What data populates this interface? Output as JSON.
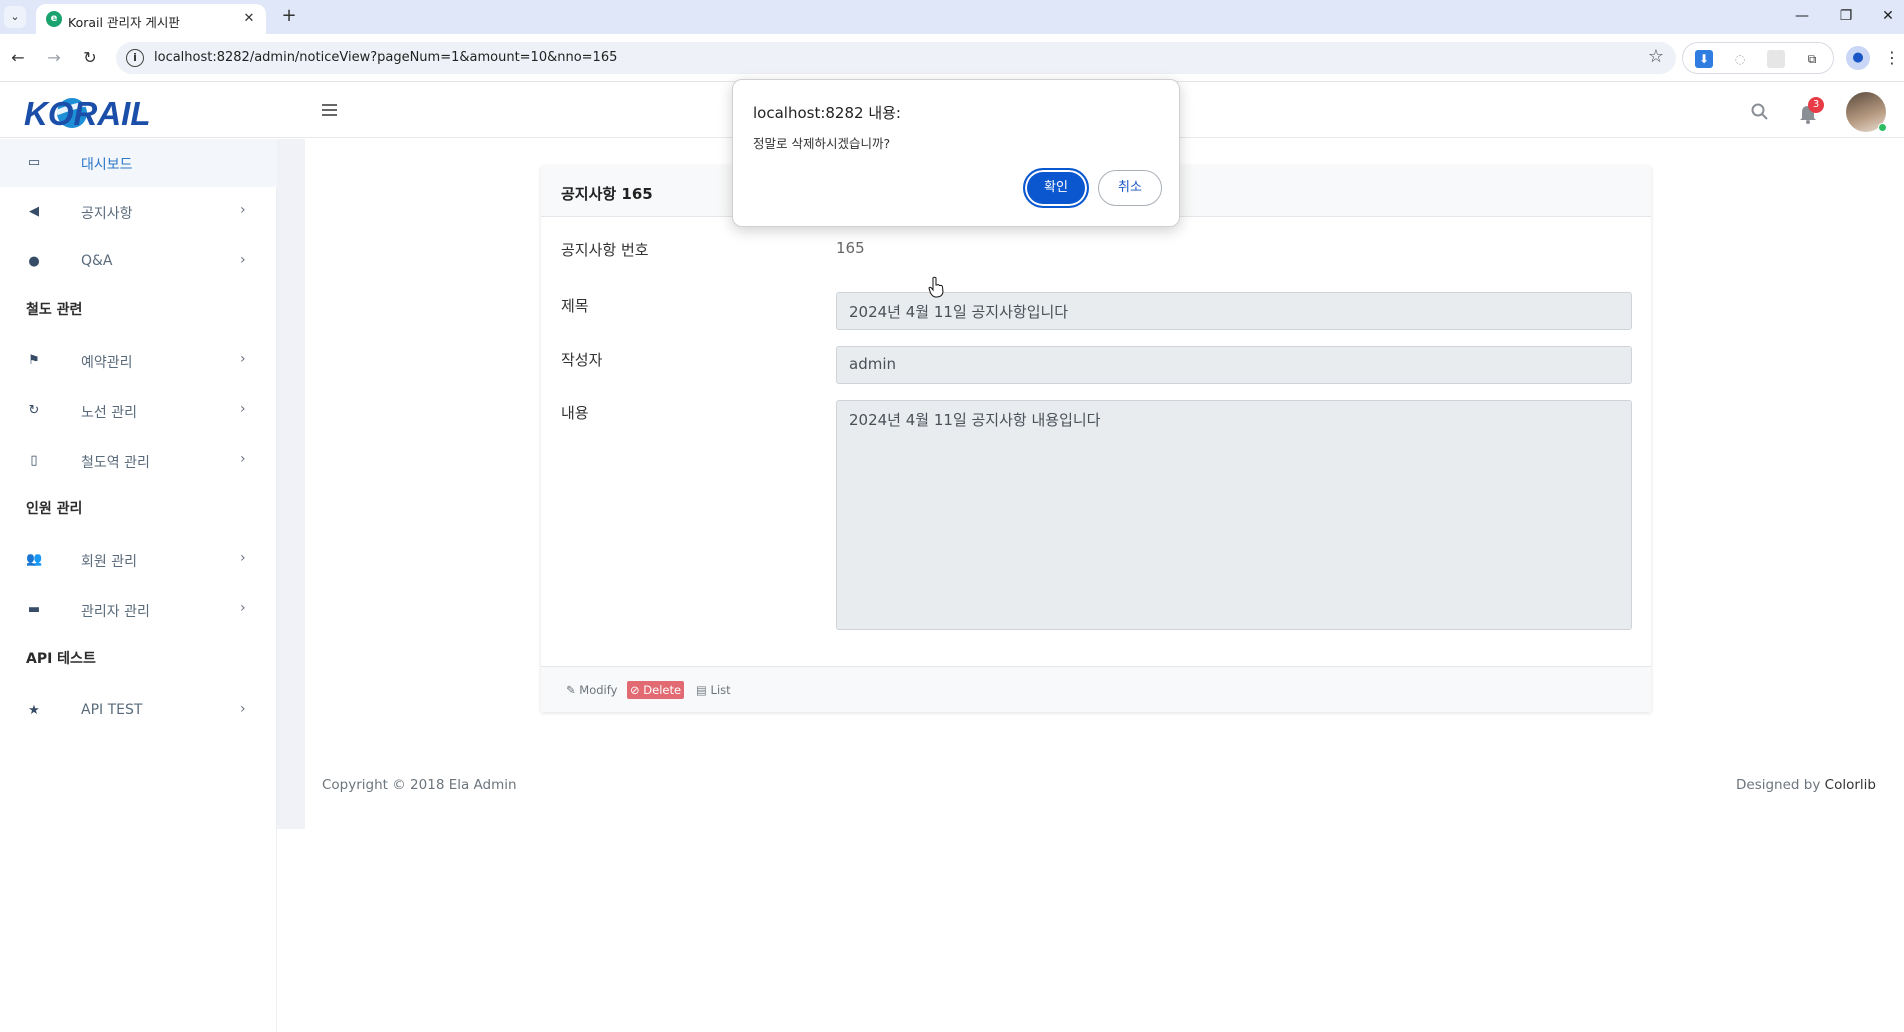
{
  "browser": {
    "tab_title": "Korail 관리자 게시판",
    "url": "localhost:8282/admin/noticeView?pageNum=1&amount=10&nno=165"
  },
  "header": {
    "logo_text": "KORAIL",
    "notification_count": "3"
  },
  "sidebar": {
    "items": [
      {
        "label": "대시보드",
        "icon": "laptop-icon"
      },
      {
        "label": "공지사항",
        "icon": "bullhorn-icon"
      },
      {
        "label": "Q&A",
        "icon": "comments-icon"
      },
      {
        "label": "예약관리",
        "icon": "flag-icon"
      },
      {
        "label": "노선 관리",
        "icon": "refresh-icon"
      },
      {
        "label": "철도역 관리",
        "icon": "building-icon"
      },
      {
        "label": "회원 관리",
        "icon": "users-icon"
      },
      {
        "label": "관리자 관리",
        "icon": "briefcase-icon"
      },
      {
        "label": "API TEST",
        "icon": "star-icon"
      }
    ],
    "sections": {
      "rail": "철도 관련",
      "people": "인원 관리",
      "api": "API 테스트"
    }
  },
  "card": {
    "title": "공지사항 165",
    "number_label": "공지사항 번호",
    "number_value": "165",
    "subject_label": "제목",
    "subject_value": "2024년 4월 11일 공지사항입니다",
    "writer_label": "작성자",
    "writer_value": "admin",
    "content_label": "내용",
    "content_value": "2024년 4월 11일 공지사항 내용입니다",
    "buttons": {
      "modify": "Modify",
      "delete": "Delete",
      "list": "List"
    }
  },
  "footer": {
    "copyright": "Copyright © 2018 Ela Admin",
    "designed_prefix": "Designed by ",
    "designed_by": "Colorlib"
  },
  "dialog": {
    "title": "localhost:8282 내용:",
    "message": "정말로 삭제하시겠습니까?",
    "ok": "확인",
    "cancel": "취소"
  },
  "colors": {
    "brand_blue": "#0b57d0",
    "delete_red": "#e16a73",
    "active_link": "#2d78c8"
  }
}
